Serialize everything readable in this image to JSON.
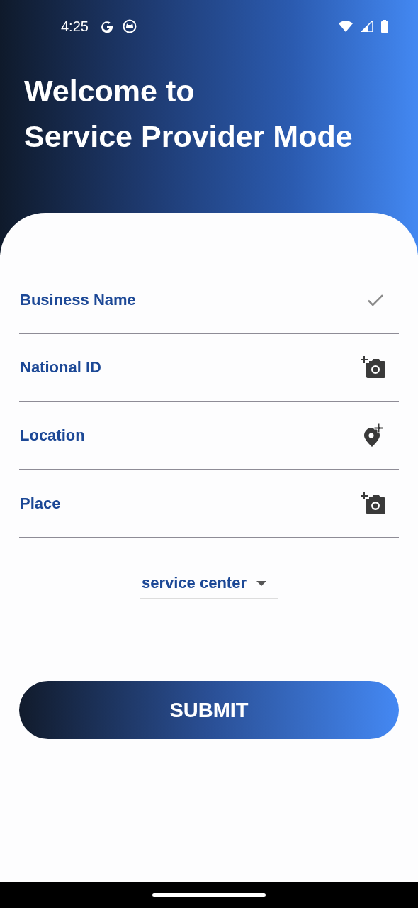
{
  "status_bar": {
    "time": "4:25"
  },
  "header": {
    "title_lines": [
      "Welcome to",
      "Service Provider Mode"
    ]
  },
  "fields": [
    {
      "label": "Business Name",
      "kind": "check"
    },
    {
      "label": "National ID",
      "kind": "add-photo"
    },
    {
      "label": "Location",
      "kind": "add-location"
    },
    {
      "label": "Place",
      "kind": "add-photo"
    }
  ],
  "dropdown": {
    "value": "service center"
  },
  "submit_button": {
    "label": "SUBMIT"
  }
}
